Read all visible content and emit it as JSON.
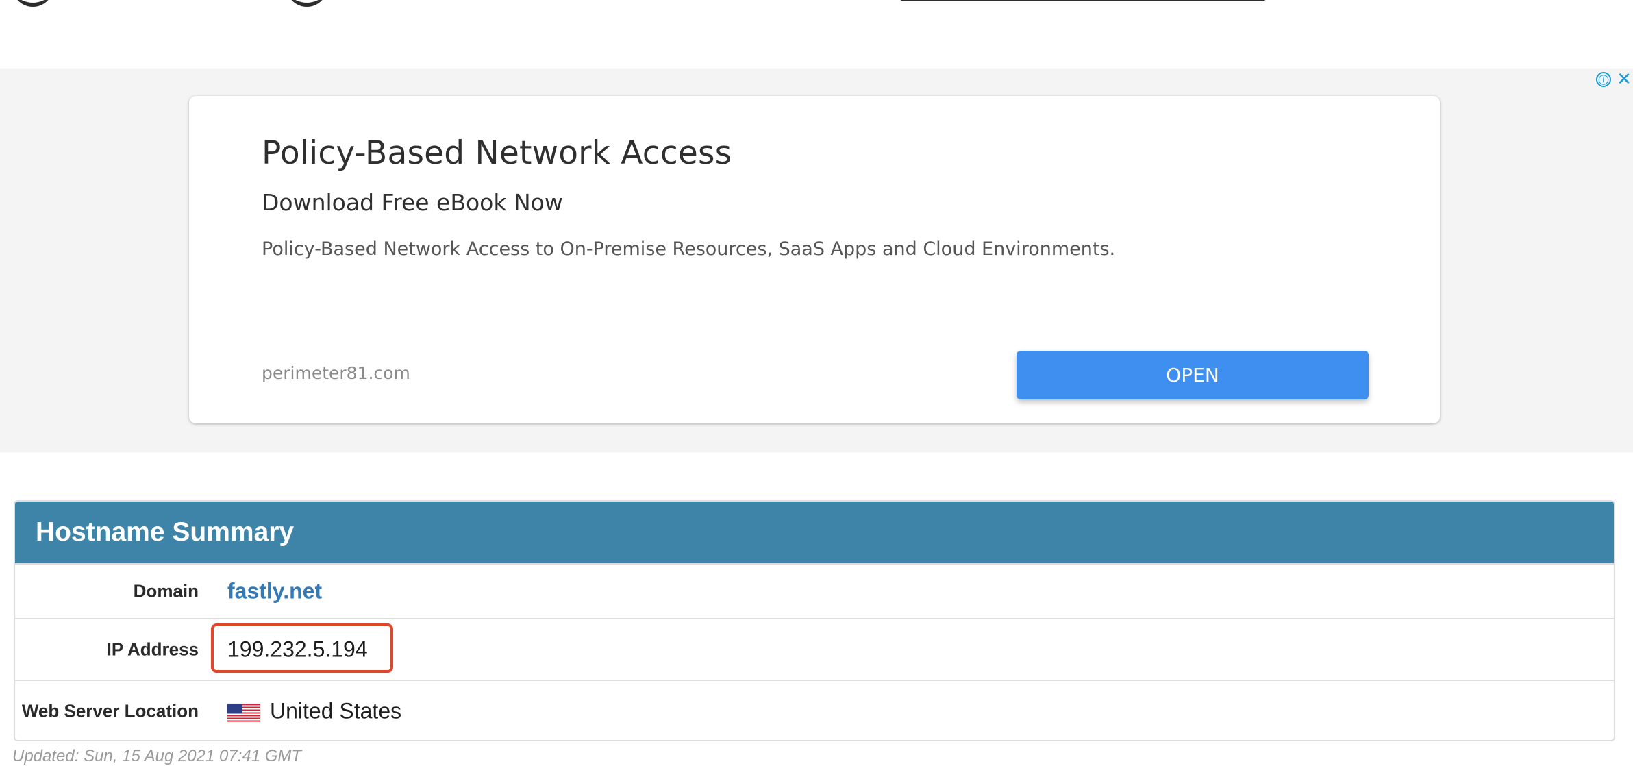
{
  "ad": {
    "title": "Policy-Based Network Access",
    "subtitle": "Download Free eBook Now",
    "description": "Policy-Based Network Access to On-Premise Resources, SaaS Apps and Cloud Environments.",
    "url": "perimeter81.com",
    "button_label": "OPEN",
    "info_icon": "ⓘ",
    "close_icon": "✕",
    "button_color": "#3f8ff0"
  },
  "summary": {
    "title": "Hostname Summary",
    "header_color": "#3d84a8",
    "rows": {
      "domain": {
        "label": "Domain",
        "value": "fastly.net"
      },
      "ip": {
        "label": "IP Address",
        "value": "199.232.5.194"
      },
      "location": {
        "label": "Web Server Location",
        "value": "United States",
        "flag_icon": "us-flag-icon"
      }
    },
    "updated": "Updated: Sun, 15 Aug 2021 07:41 GMT"
  },
  "highlight_color": "#e0462c"
}
